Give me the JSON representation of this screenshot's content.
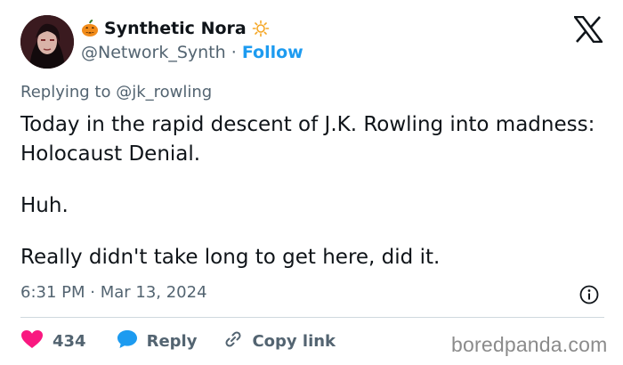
{
  "author": {
    "display_name": "Synthetic Nora",
    "handle": "@Network_Synth",
    "separator": "·",
    "follow_label": "Follow",
    "name_emojis": [
      "jack-o-lantern-icon",
      "sun-icon"
    ]
  },
  "reply_context": {
    "prefix": "Replying to",
    "mention": "@jk_rowling"
  },
  "tweet": {
    "lines": [
      "Today in the rapid descent of J.K. Rowling into madness: Holocaust Denial.",
      "Huh.",
      "Really didn't take long to get here, did it."
    ],
    "timestamp": "6:31 PM · Mar 13, 2024"
  },
  "actions": {
    "like_count": "434",
    "reply_label": "Reply",
    "copy_link_label": "Copy link"
  },
  "watermark": "boredpanda.com",
  "colors": {
    "follow_blue": "#1d9bf0",
    "like_pink": "#f91880",
    "reply_blue": "#1d9bf0",
    "text_dark": "#0f1419",
    "text_gray": "#536471"
  }
}
